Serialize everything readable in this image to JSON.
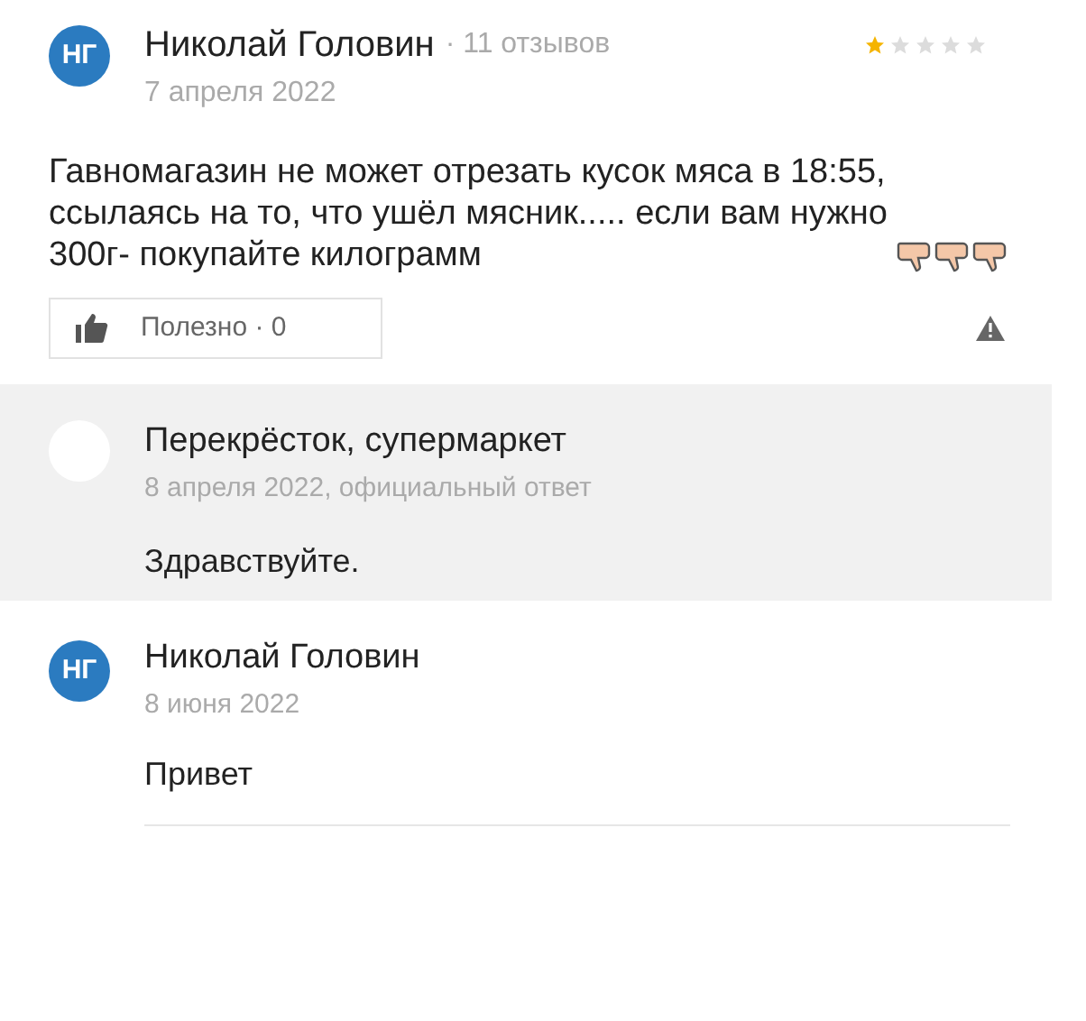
{
  "review": {
    "avatar_initials": "НГ",
    "author": "Николай Головин",
    "reviews_count": "· 11 отзывов",
    "stars": 1,
    "date": "7 апреля 2022",
    "text": "Гавномагазин не может отрезать кусок мяса в 18:55, ссылаясь на то, что ушёл мясник..... если вам нужно 300г- покупайте килограмм",
    "emoji": [
      {
        "kind": "thumb-down"
      },
      {
        "kind": "thumb-down"
      },
      {
        "kind": "thumb-down"
      }
    ],
    "useful_button": {
      "label": "Полезно · 0"
    }
  },
  "official_reply": {
    "author": "Перекрёсток, супермаркет",
    "date": "8 апреля 2022, официальный ответ",
    "text": "Здравствуйте."
  },
  "comment": {
    "avatar_initials": "НГ",
    "author": "Николай Головин",
    "date": "8 июня 2022",
    "text": "Привет"
  }
}
